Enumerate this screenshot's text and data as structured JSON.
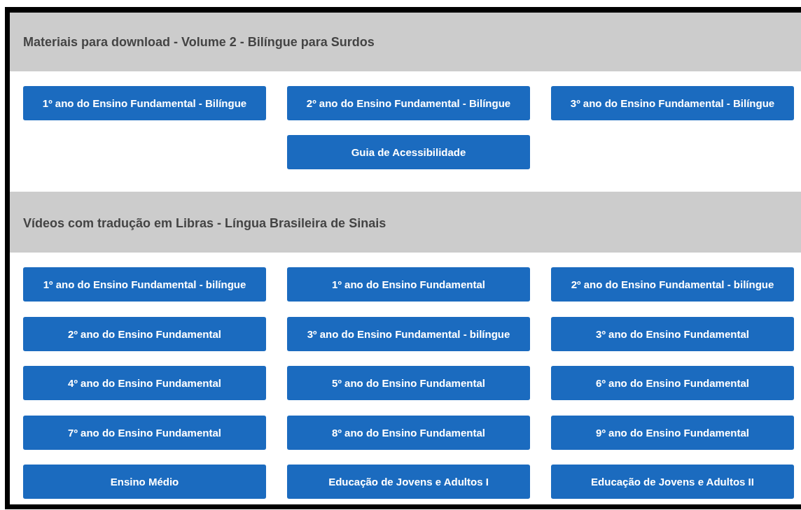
{
  "sections": [
    {
      "title": "Materiais para download - Volume 2 - Bilíngue para Surdos",
      "buttons": [
        "1º ano do Ensino Fundamental - Bilíngue",
        "2º ano do Ensino Fundamental - Bilíngue",
        "3º ano do Ensino Fundamental - Bilíngue",
        "Guia de Acessibilidade"
      ]
    },
    {
      "title": "Vídeos com tradução em Libras - Língua Brasileira de Sinais",
      "buttons": [
        "1º ano do Ensino Fundamental - bilíngue",
        "1º ano do Ensino Fundamental",
        "2º ano do Ensino Fundamental - bilíngue",
        "2º ano do Ensino Fundamental",
        "3º ano do Ensino Fundamental - bilíngue",
        "3º ano do Ensino Fundamental",
        "4º ano do Ensino Fundamental",
        "5º ano do Ensino Fundamental",
        "6º ano do Ensino Fundamental",
        "7º ano do Ensino Fundamental",
        "8º ano do Ensino Fundamental",
        "9º ano do Ensino Fundamental",
        "Ensino Médio",
        "Educação de Jovens e Adultos I",
        "Educação de Jovens e Adultos II"
      ]
    }
  ]
}
